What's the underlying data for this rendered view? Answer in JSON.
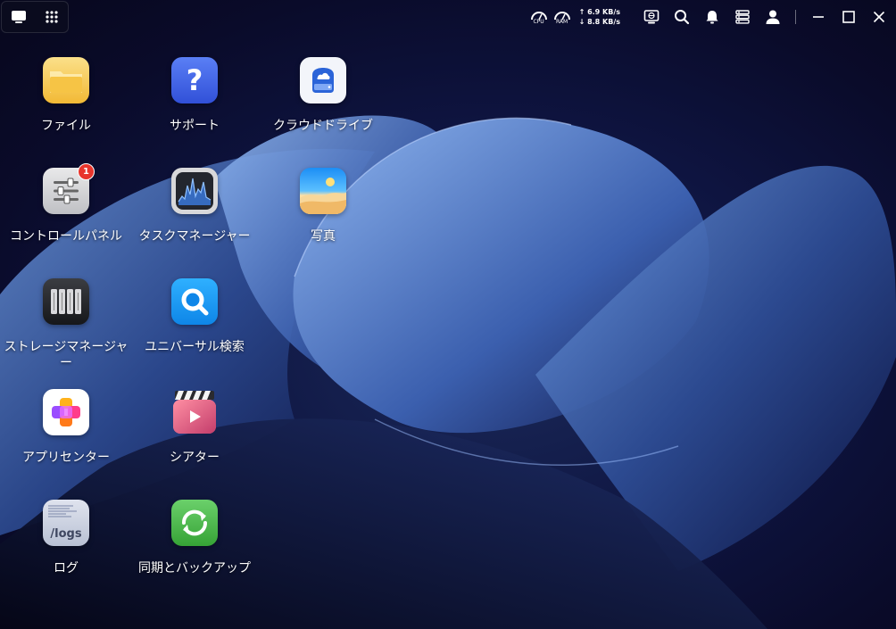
{
  "topbar": {
    "cpu_label": "CPU",
    "ram_label": "RAM",
    "upload": "6.9 KB/s",
    "download": "8.8 KB/s"
  },
  "apps": [
    {
      "label": "ファイル",
      "icon": "folder-icon"
    },
    {
      "label": "サポート",
      "icon": "question-icon"
    },
    {
      "label": "クラウドドライブ",
      "icon": "cloud-drive-icon"
    },
    {
      "label": "コントロールパネル",
      "icon": "sliders-icon",
      "badge": "1"
    },
    {
      "label": "タスクマネージャー",
      "icon": "activity-chart-icon"
    },
    {
      "label": "写真",
      "icon": "photo-icon"
    },
    {
      "label": "ストレージマネージャー",
      "icon": "drive-bays-icon"
    },
    {
      "label": "ユニバーサル検索",
      "icon": "search-icon"
    },
    {
      "label": "アプリセンター",
      "icon": "app-center-icon"
    },
    {
      "label": "シアター",
      "icon": "clapperboard-icon"
    },
    {
      "label": "ログ",
      "icon": "logs-icon",
      "icon_text": "/logs"
    },
    {
      "label": "同期とバックアップ",
      "icon": "sync-icon"
    }
  ],
  "colors": {
    "support": "#3a6cf0",
    "folder": "#f4c24a",
    "search": "#1a9af0",
    "sync": "#4cbb4c",
    "badge": "#e8352c"
  }
}
